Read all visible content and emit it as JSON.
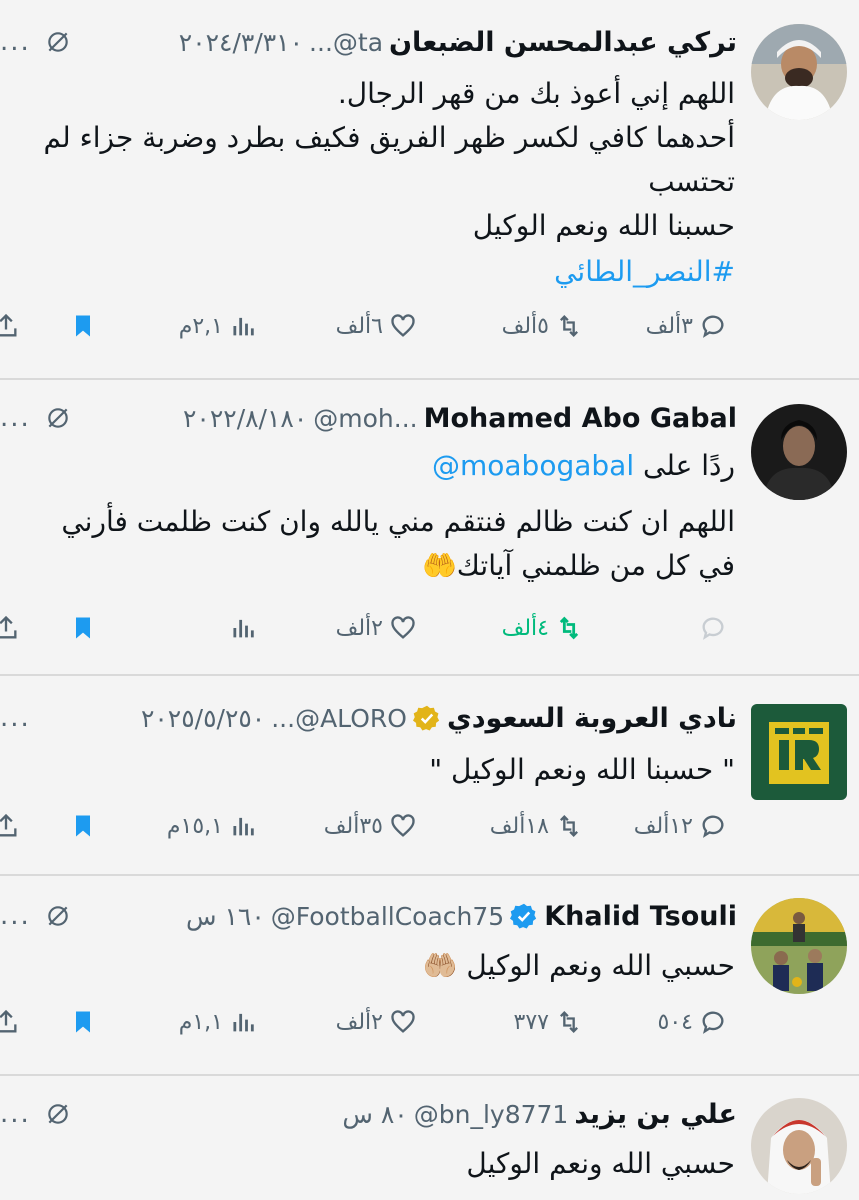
{
  "colors": {
    "link": "#1d9bf0",
    "gray": "#536471",
    "green": "#00ba7c",
    "bookmark": "#1d9bf0"
  },
  "tweets": [
    {
      "name": "تركي عبدالمحسن الضبعان",
      "handle": "...@ta",
      "date": "٢٠٢٤/٣/٣١٠",
      "more": "...",
      "lines": [
        "اللهم إني أعوذ بك من قهر الرجال.",
        "أحدهما كافي لكسر ظهر الفريق فكيف بطرد وضربة جزاء لم",
        "تحتسب",
        "حسبنا الله ونعم الوكيل"
      ],
      "hashtag": "#النصر_الطائي",
      "replies": "٣ألف",
      "retweets": "٥ألف",
      "likes": "٦ألف",
      "views": "٢,١م"
    },
    {
      "name": "Mohamed Abo Gabal",
      "handle": "@moh...",
      "date": "٢٠٢٢/٨/١٨٠",
      "more": "...",
      "reply_prefix": "ردًا على",
      "reply_to": "@moabogabal",
      "lines": [
        "اللهم ان كنت ظالم فنتقم مني يالله وان كنت ظلمت فأرني",
        "في كل من ظلمني آياتك🤲"
      ],
      "replies": "",
      "retweets": "٤ألف",
      "likes": "٢ألف",
      "views": ""
    },
    {
      "name": "نادي العروبة السعودي",
      "handle": "...@ALORO",
      "date": "٢٠٢٥/٥/٢٥٠",
      "more": "...",
      "lines": [
        "\" حسبنا الله ونعم الوكيل \""
      ],
      "replies": "١٢ألف",
      "retweets": "١٨ألف",
      "likes": "٣٥ألف",
      "views": "١٥,١م"
    },
    {
      "name": "Khalid Tsouli",
      "handle": "@FootballCoach75",
      "date": "١٦٠ س",
      "more": "...",
      "lines": [
        "حسبي الله ونعم الوكيل 🤲🏼"
      ],
      "replies": "٥٠٤",
      "retweets": "٣٧٧",
      "likes": "٢ألف",
      "views": "١,١م"
    },
    {
      "name": "علي بن يزيد",
      "handle": "@bn_ly8771",
      "date": "٨٠ س",
      "more": "...",
      "lines": [
        "حسبي الله ونعم الوكيل"
      ]
    }
  ],
  "icons": {
    "reply": "reply-icon",
    "retweet": "retweet-icon",
    "like": "heart-icon",
    "views": "views-icon",
    "bookmark": "bookmark-icon",
    "share": "share-icon",
    "grok": "grok-icon",
    "verified": "verified-badge-icon"
  }
}
